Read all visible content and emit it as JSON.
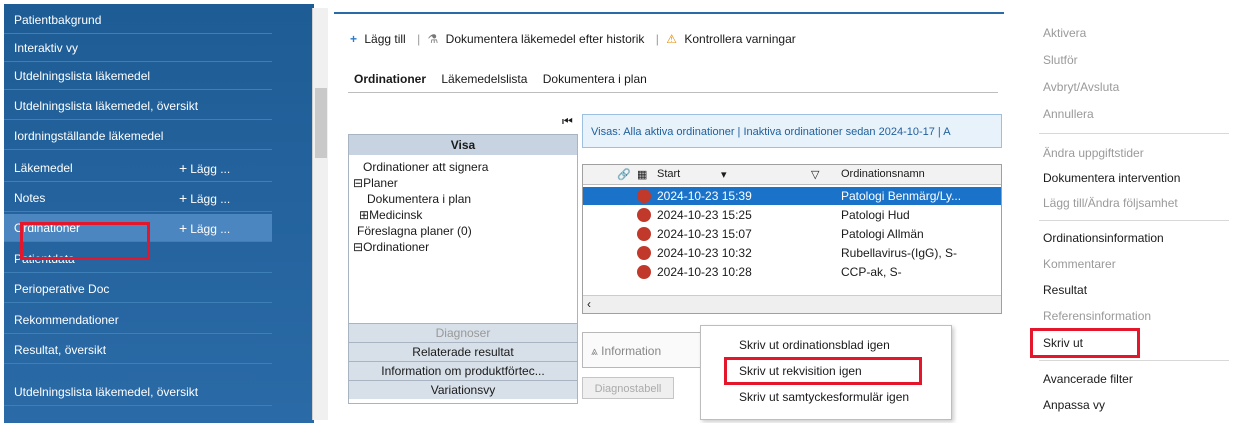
{
  "left_nav": {
    "items": [
      {
        "label": "Patientbakgrund"
      },
      {
        "label": "Interaktiv vy"
      },
      {
        "label": "Utdelningslista läkemedel"
      },
      {
        "label": "Utdelningslista läkemedel, översikt"
      },
      {
        "label": "Iordningställande läkemedel"
      },
      {
        "label": "Läkemedel",
        "add": "Lägg ..."
      },
      {
        "label": "Notes",
        "add": "Lägg ..."
      },
      {
        "label": "Ordinationer",
        "add": "Lägg ..."
      },
      {
        "label": "Patientdata"
      },
      {
        "label": "Perioperative Doc"
      },
      {
        "label": "Rekommendationer"
      },
      {
        "label": "Resultat, översikt"
      },
      {
        "label": "Utdelningslista läkemedel, översikt"
      }
    ]
  },
  "toolbar": {
    "add": "Lägg till",
    "document": "Dokumentera läkemedel efter historik",
    "check": "Kontrollera varningar"
  },
  "tabs": [
    "Ordinationer",
    "Läkemedelslista",
    "Dokumentera i plan"
  ],
  "vis_panel": {
    "header": "Visa",
    "tree": [
      "Ordinationer att signera",
      "Planer",
      "Dokumentera i plan",
      "Medicinsk",
      "Föreslagna planer (0)",
      "Ordinationer"
    ],
    "sections": [
      "Diagnoser",
      "Relaterade resultat",
      "Information om produktförtec...",
      "Variationsvy"
    ]
  },
  "filter_text": "Visas: Alla aktiva ordinationer | Inaktiva ordinationer sedan 2024-10-17 | A",
  "grid": {
    "col_start": "Start",
    "col_name": "Ordinationsnamn",
    "rows": [
      {
        "start": "2024-10-23 15:39",
        "name": "Patologi Benmärg/Ly..."
      },
      {
        "start": "2024-10-23 15:25",
        "name": "Patologi Hud"
      },
      {
        "start": "2024-10-23 15:07",
        "name": "Patologi Allmän"
      },
      {
        "start": "2024-10-23 10:32",
        "name": "Rubellavirus-(IgG), S-"
      },
      {
        "start": "2024-10-23 10:28",
        "name": "CCP-ak, S-"
      }
    ]
  },
  "info_label": "Information",
  "diag_button": "Diagnostabell",
  "popup": {
    "items": [
      "Skriv ut ordinationsblad igen",
      "Skriv ut rekvisition igen",
      "Skriv ut samtyckesformulär igen"
    ]
  },
  "context_menu": {
    "items": [
      "Aktivera",
      "Slutför",
      "Avbryt/Avsluta",
      "Annullera",
      "Ändra uppgiftstider",
      "Dokumentera intervention",
      "Lägg till/Ändra följsamhet",
      "Ordinationsinformation",
      "Kommentarer",
      "Resultat",
      "Referensinformation",
      "Skriv ut",
      "Avancerade filter",
      "Anpassa vy"
    ]
  },
  "colors": {
    "nav_bg": "#1e5c95",
    "selected_row": "#1a73c9",
    "highlight": "#e3162c"
  }
}
